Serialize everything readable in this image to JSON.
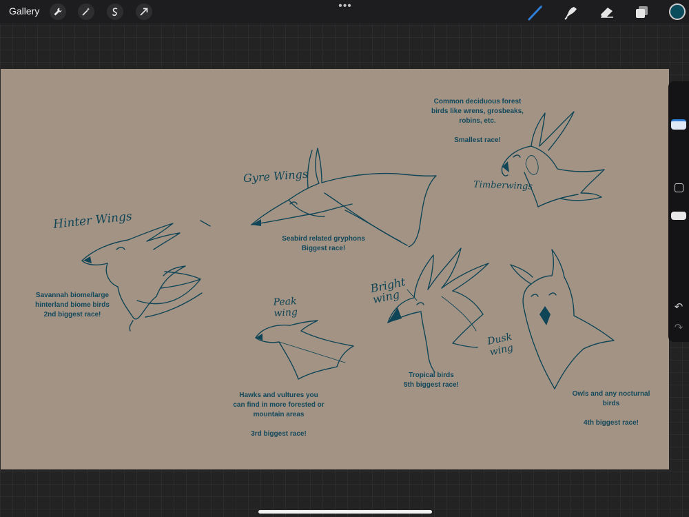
{
  "topbar": {
    "gallery_label": "Gallery",
    "left_tools": [
      "wrench-icon",
      "magic-wand-icon",
      "selection-s-icon",
      "transform-arrow-icon"
    ],
    "more_label": "•••",
    "right_tools": [
      "brush-icon",
      "smudge-icon",
      "eraser-icon",
      "layers-icon"
    ],
    "accent_color": "#2f7fd8",
    "current_color": "#0a4b5c"
  },
  "canvas": {
    "background": "#a39384",
    "ink": "#0f4556",
    "labels": {
      "hinter": "Hinter Wings",
      "gyre": "Gyre Wings",
      "timber": "Timberwings",
      "peak": "Peak\nwing",
      "bright": "Bright\nwing",
      "dusk": "Dusk\nwing"
    },
    "notes": {
      "savannah": "Savannah biome/large\nhinterland biome birds\n2nd biggest race!",
      "seabird": "Seabird related gryphons\nBiggest race!",
      "forest": "Common deciduous forest\nbirds like wrens, grosbeaks,\nrobins, etc.\n\nSmallest race!",
      "hawks": "Hawks and vultures you\ncan find in more forested or\nmountain areas\n\n3rd biggest race!",
      "tropical": "Tropical birds\n5th biggest race!",
      "owls": "Owls and any nocturnal\nbirds\n\n4th biggest race!"
    }
  },
  "sidebar": {
    "brush_size_level": 0.27,
    "opacity_level": 0.56,
    "undo_icon": "undo-icon",
    "redo_icon": "redo-icon"
  }
}
